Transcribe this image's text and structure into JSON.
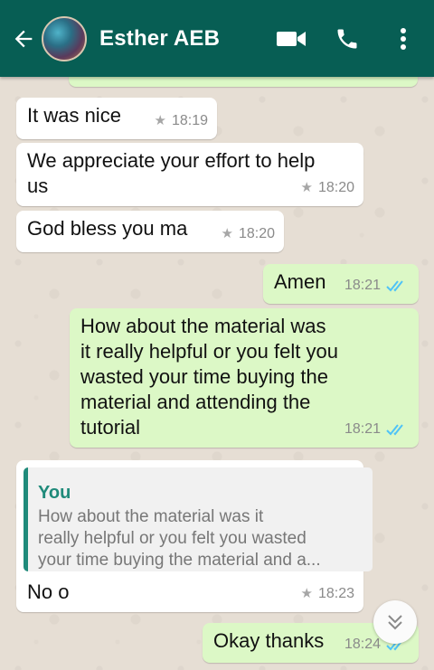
{
  "header": {
    "contact_name": "Esther AEB",
    "back_icon": "arrow-left-icon",
    "video_icon": "video-camera-icon",
    "call_icon": "phone-icon",
    "menu_icon": "more-vertical-icon",
    "color": "#075e54"
  },
  "messages": [
    {
      "direction": "in",
      "text": "It was nice",
      "time": "18:19",
      "starred": true
    },
    {
      "direction": "in",
      "text_line1": "We appreciate your effort to help",
      "text_line2": "us",
      "time": "18:20",
      "starred": true
    },
    {
      "direction": "in",
      "text": "God bless you ma",
      "time": "18:20",
      "starred": true
    },
    {
      "direction": "out",
      "text": "Amen",
      "time": "18:21",
      "read": true
    },
    {
      "direction": "out",
      "lines": [
        "How about the material was",
        "it really helpful or you felt you",
        "wasted your time buying the",
        "material and attending the",
        "tutorial"
      ],
      "time": "18:21",
      "read": true
    },
    {
      "direction": "in",
      "quote_author": "You",
      "quote_lines": [
        "How about the material was it",
        "really helpful or you felt you wasted",
        "your time buying the material and a..."
      ],
      "text": "No o",
      "time": "18:23",
      "starred": true
    },
    {
      "direction": "out",
      "text": "Okay thanks",
      "time": "18:24",
      "read": true
    }
  ],
  "colors": {
    "incoming": "#ffffff",
    "outgoing": "#dcf8c6",
    "read_ticks": "#4fc3f7",
    "quote_accent": "#1f8a7a"
  },
  "scroll_button_icon": "chevron-double-down-icon"
}
